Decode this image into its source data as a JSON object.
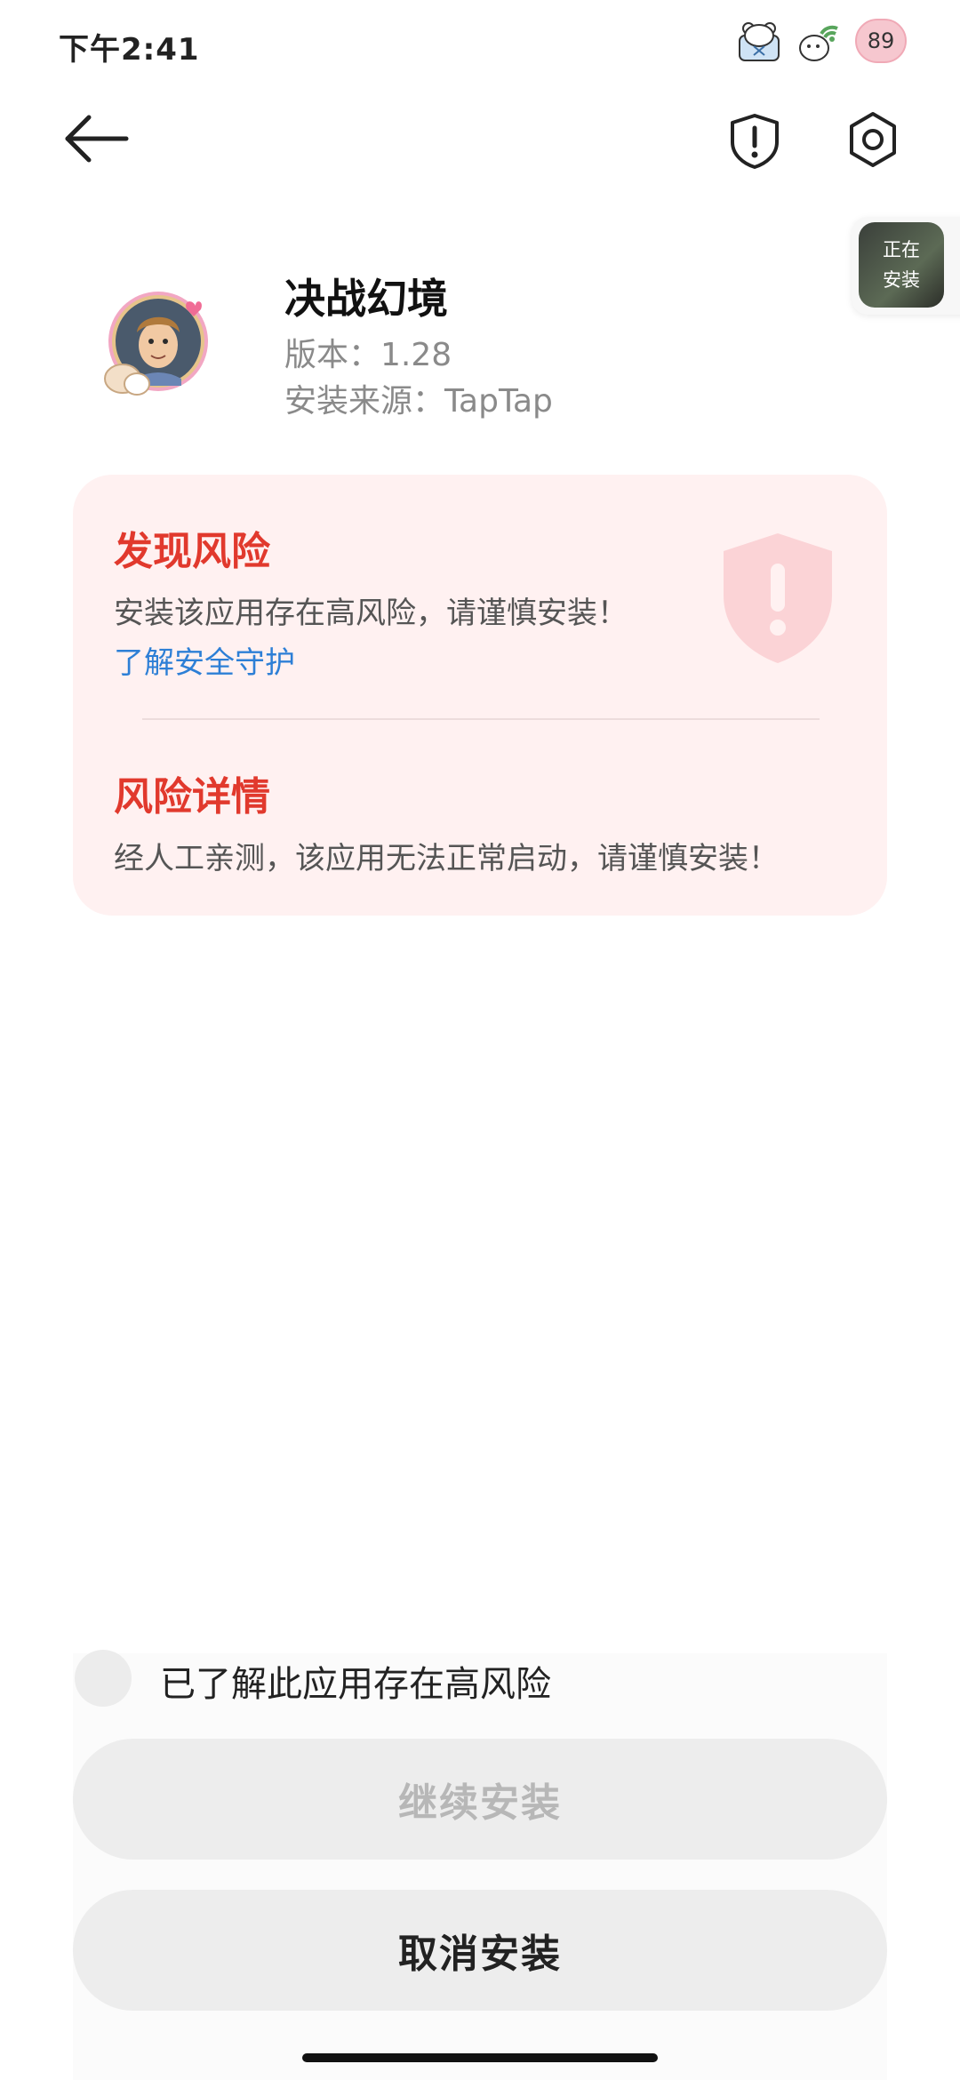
{
  "status_bar": {
    "time": "下午2:41",
    "battery": "89",
    "icons": [
      "bear-sticker-icon",
      "wifi-bear-sticker-icon",
      "battery-icon"
    ]
  },
  "top_bar": {
    "back_icon": "arrow-left-icon",
    "shield_icon": "shield-alert-icon",
    "settings_icon": "gear-icon"
  },
  "installing_tag": {
    "line1": "正在",
    "line2": "安装"
  },
  "app": {
    "name": "决战幻境",
    "version": "版本：1.28",
    "source": "安装来源：TapTap"
  },
  "risk": {
    "title": "发现风险",
    "description": "安装该应用存在高风险，请谨慎安装！",
    "link": "了解安全守护",
    "detail_title": "风险详情",
    "detail_description": "经人工亲测，该应用无法正常启动，请谨慎安装！",
    "accent_color": "#e1392d",
    "link_color": "#2d7fd6"
  },
  "footer": {
    "acknowledge_label": "已了解此应用存在高风险",
    "acknowledge_checked": false,
    "continue_label": "继续安装",
    "cancel_label": "取消安装"
  }
}
